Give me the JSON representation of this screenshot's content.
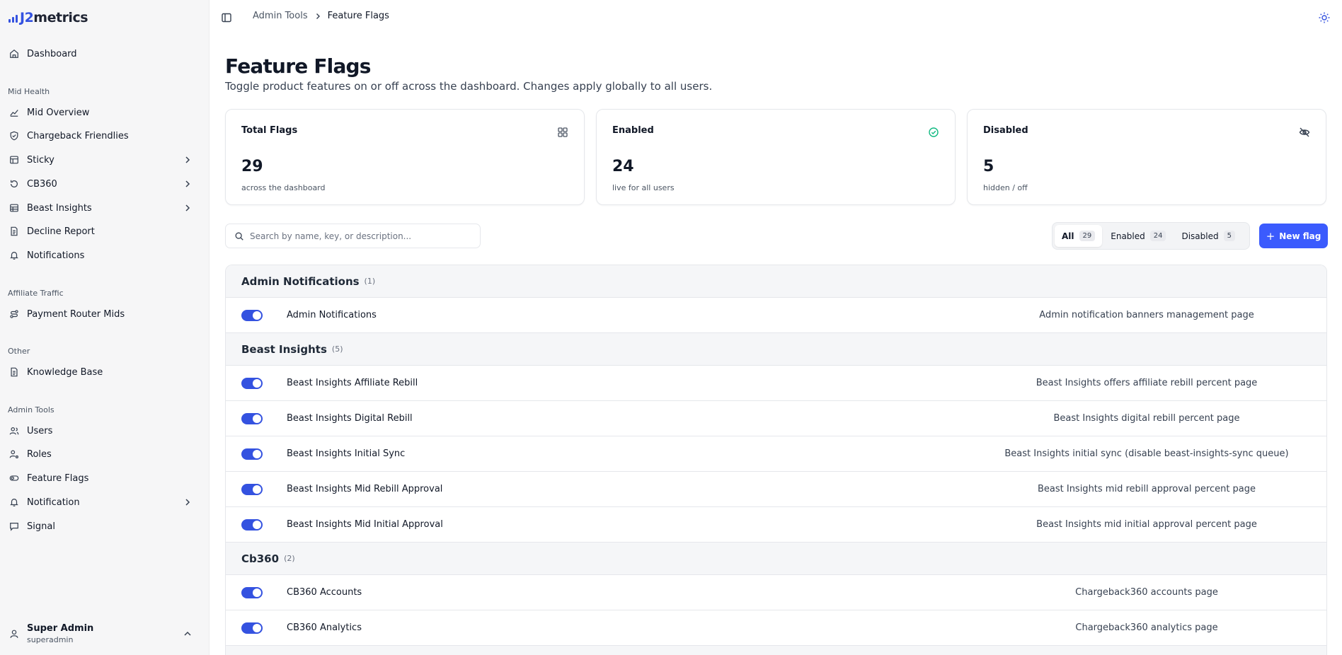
{
  "brand": {
    "logo_prefix": "J2",
    "logo_suffix": "metrics",
    "accent": "#3452e0"
  },
  "sidebar": {
    "items": [
      {
        "label": "Dashboard"
      },
      {
        "label": "Mid Overview"
      },
      {
        "label": "Chargeback Friendlies"
      },
      {
        "label": "Sticky"
      },
      {
        "label": "CB360"
      },
      {
        "label": "Beast Insights"
      },
      {
        "label": "Decline Report"
      },
      {
        "label": "Notifications"
      },
      {
        "label": "Payment Router Mids"
      },
      {
        "label": "Knowledge Base"
      },
      {
        "label": "Users"
      },
      {
        "label": "Roles"
      },
      {
        "label": "Feature Flags"
      },
      {
        "label": "Notification"
      },
      {
        "label": "Signal"
      }
    ],
    "sections": [
      "Mid Health",
      "Affiliate Traffic",
      "Other",
      "Admin Tools"
    ],
    "user": {
      "name": "Super Admin",
      "role": "superadmin"
    }
  },
  "breadcrumb": {
    "parent": "Admin Tools",
    "current": "Feature Flags"
  },
  "page": {
    "title": "Feature Flags",
    "subtitle": "Toggle product features on or off across the dashboard. Changes apply globally to all users."
  },
  "stats": [
    {
      "title": "Total Flags",
      "value": "29",
      "sub": "across the dashboard",
      "icon": "grid-icon"
    },
    {
      "title": "Enabled",
      "value": "24",
      "sub": "live for all users",
      "icon": "check-circle-icon"
    },
    {
      "title": "Disabled",
      "value": "5",
      "sub": "hidden / off",
      "icon": "eye-off-icon"
    }
  ],
  "search": {
    "placeholder": "Search by name, key, or description..."
  },
  "filters": [
    {
      "label": "All",
      "count": "29"
    },
    {
      "label": "Enabled",
      "count": "24"
    },
    {
      "label": "Disabled",
      "count": "5"
    }
  ],
  "new_flag_label": "New flag",
  "groups": [
    {
      "name": "Admin Notifications",
      "count": "(1)",
      "flags": [
        {
          "name": "Admin Notifications",
          "desc": "Admin notification banners management page",
          "enabled": true
        }
      ]
    },
    {
      "name": "Beast Insights",
      "count": "(5)",
      "flags": [
        {
          "name": "Beast Insights Affiliate Rebill",
          "desc": "Beast Insights offers affiliate rebill percent page",
          "enabled": true
        },
        {
          "name": "Beast Insights Digital Rebill",
          "desc": "Beast Insights digital rebill percent page",
          "enabled": true
        },
        {
          "name": "Beast Insights Initial Sync",
          "desc": "Beast Insights initial sync (disable beast-insights-sync queue)",
          "enabled": true
        },
        {
          "name": "Beast Insights Mid Rebill Approval",
          "desc": "Beast Insights mid rebill approval percent page",
          "enabled": true
        },
        {
          "name": "Beast Insights Mid Initial Approval",
          "desc": "Beast Insights mid initial approval percent page",
          "enabled": true
        }
      ]
    },
    {
      "name": "Cb360",
      "count": "(2)",
      "flags": [
        {
          "name": "CB360 Accounts",
          "desc": "Chargeback360 accounts page",
          "enabled": true
        },
        {
          "name": "CB360 Analytics",
          "desc": "Chargeback360 analytics page",
          "enabled": true
        }
      ]
    }
  ]
}
